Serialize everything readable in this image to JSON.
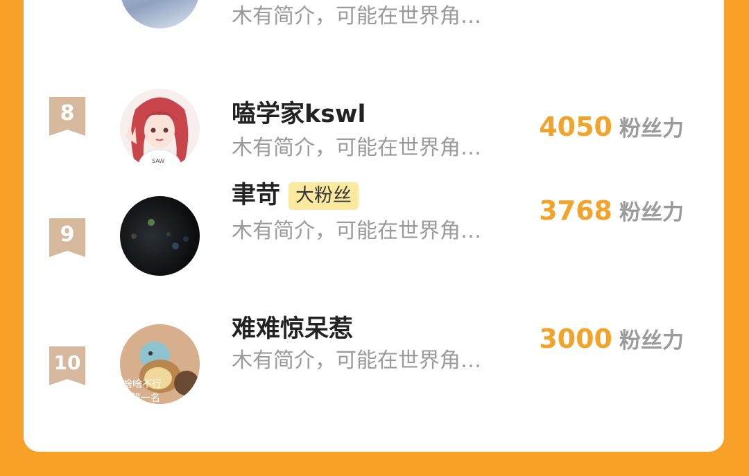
{
  "list": [
    {
      "rank": "",
      "name": "",
      "badge": "",
      "desc": "木有简介，可能在世界角…",
      "score": "",
      "unit": ""
    },
    {
      "rank": "8",
      "name": "嗑学家kswl",
      "badge": "",
      "desc": "木有简介，可能在世界角…",
      "score": "4050",
      "unit": "粉丝力"
    },
    {
      "rank": "9",
      "name": "聿苛",
      "badge": "大粉丝",
      "desc": "木有简介，可能在世界角…",
      "score": "3768",
      "unit": "粉丝力"
    },
    {
      "rank": "10",
      "name": "难难惊呆惹",
      "badge": "",
      "desc": "木有简介，可能在世界角…",
      "score": "3000",
      "unit": "粉丝力",
      "avatar_caption_1": "啥啥不行",
      "avatar_caption_2": "第一名"
    }
  ],
  "colors": {
    "accent": "#f2a329",
    "background": "#f7a128",
    "rank_badge": "#d6b99c",
    "big_fan_badge": "#fbe9a0"
  }
}
